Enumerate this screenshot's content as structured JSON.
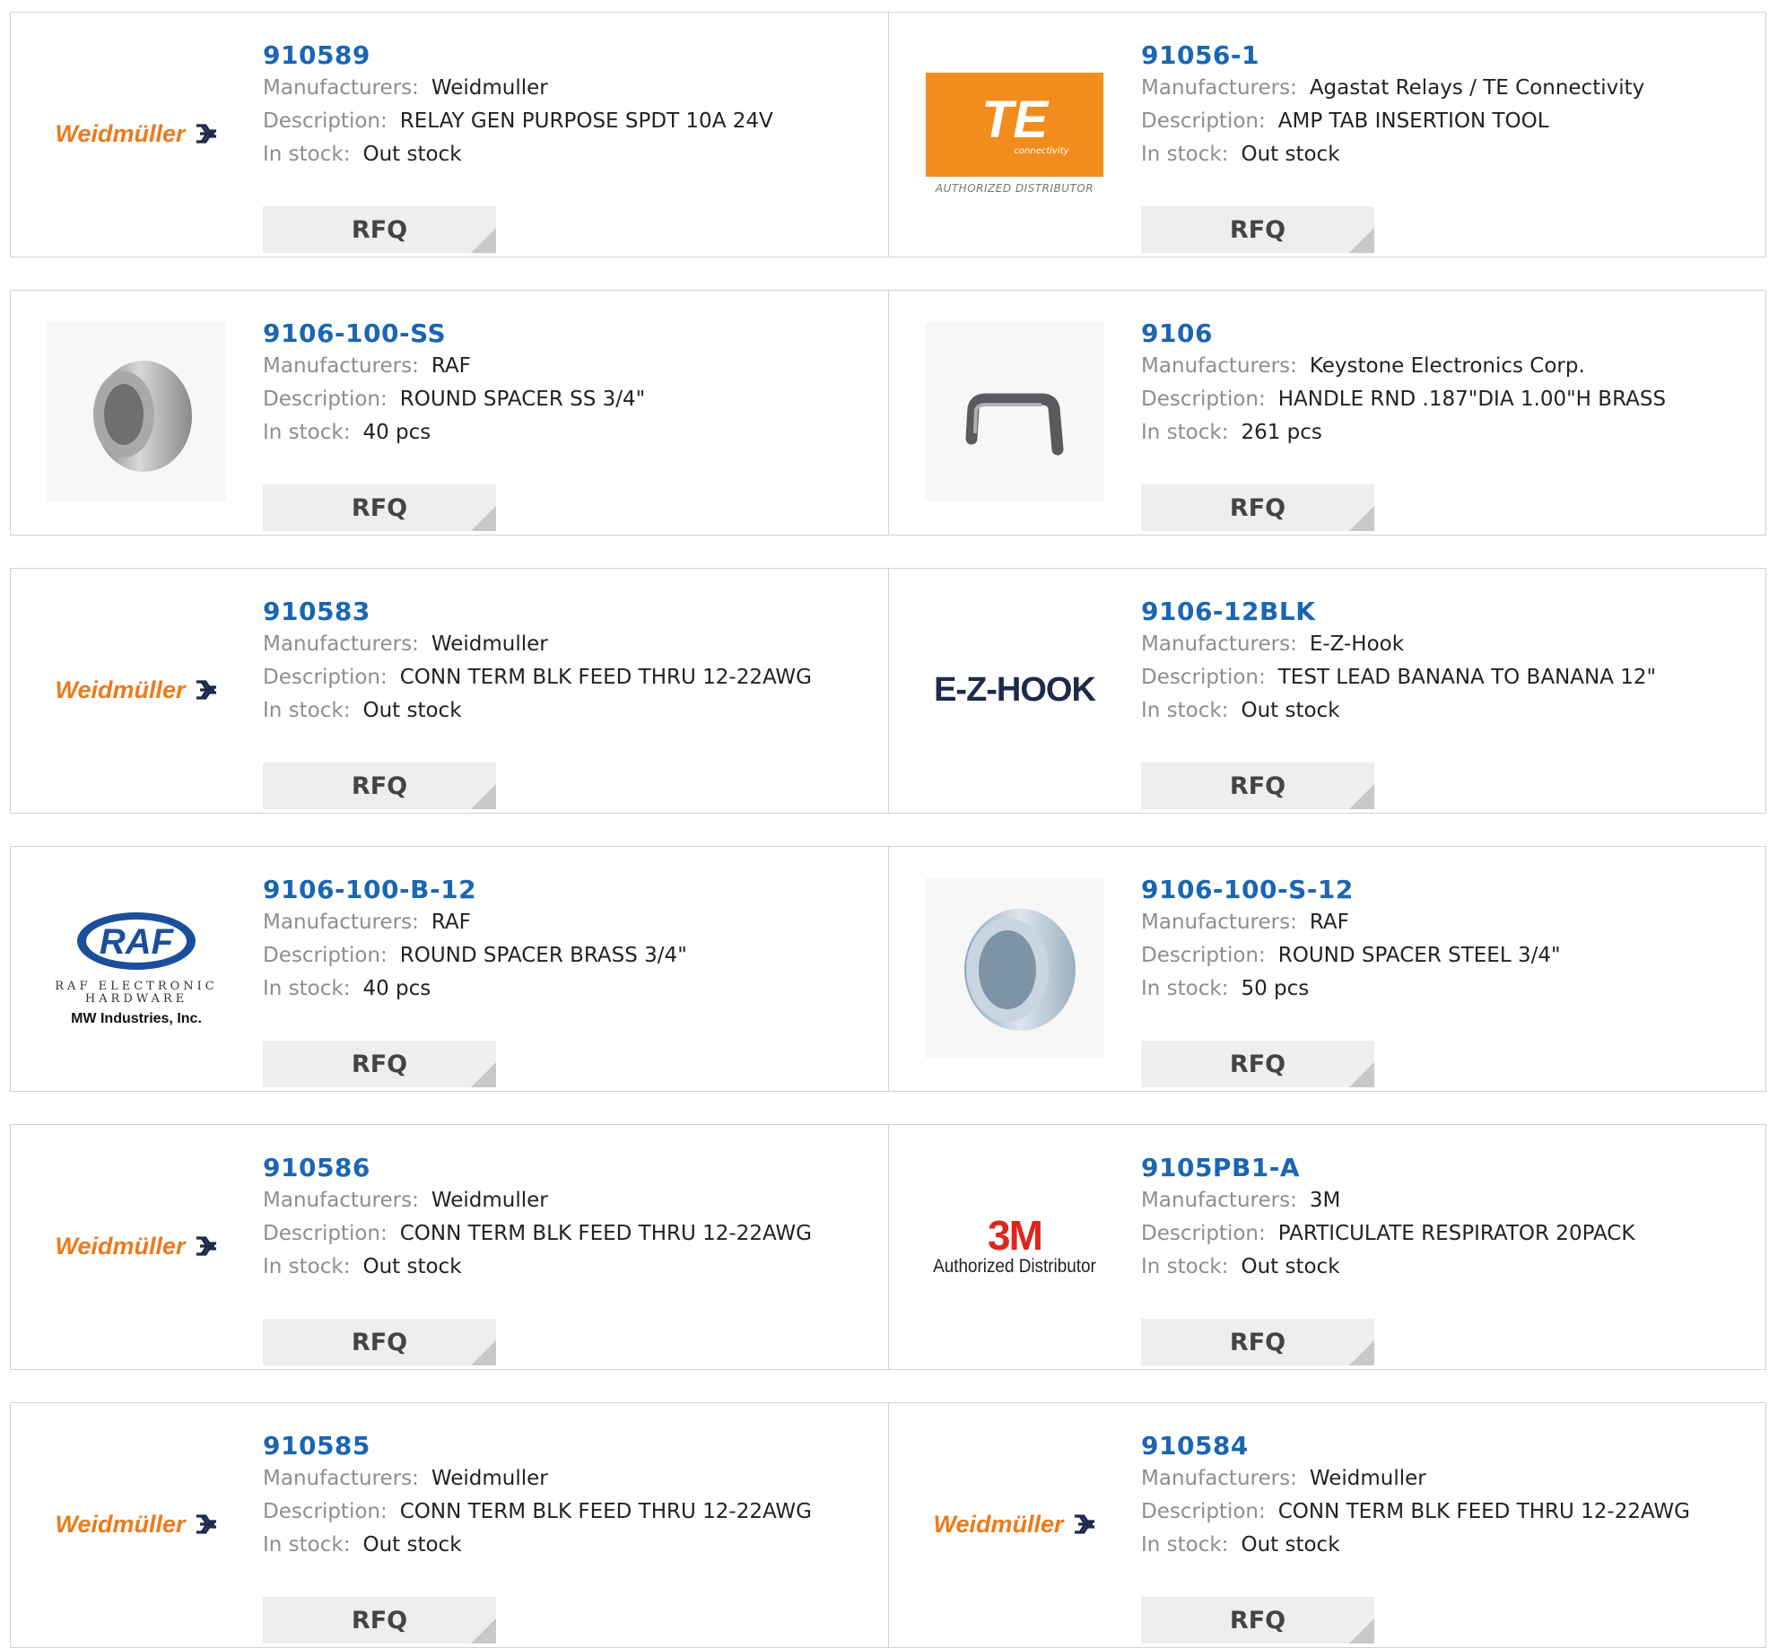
{
  "rfq_label": "RFQ",
  "labels": {
    "manufacturers": "Manufacturers:",
    "description": "Description:",
    "in_stock": "In stock:"
  },
  "logos": {
    "weidmuller": "Weidmüller",
    "te": "TE",
    "te_sub": "connectivity",
    "te_auth": "AUTHORIZED DISTRIBUTOR",
    "ezhook": "E-Z-HOOK",
    "raf": "RAF",
    "raf_sub1": "RAF ELECTRONIC",
    "raf_sub1b": "HARDWARE",
    "raf_sub2": "MW Industries, Inc.",
    "m3": "3M",
    "m3_auth": "Authorized Distributor"
  },
  "colors": {
    "part_link": "#1a66b3",
    "weidmuller_orange": "#ec7a1b",
    "te_orange": "#f28c1c",
    "m3_red": "#e1251b"
  },
  "products": [
    {
      "part": "910589",
      "manufacturer": "Weidmuller",
      "description": "RELAY GEN PURPOSE SPDT 10A 24V",
      "stock": "Out stock",
      "logo": "weidmuller"
    },
    {
      "part": "91056-1",
      "manufacturer": "Agastat Relays / TE Connectivity",
      "description": "AMP TAB INSERTION TOOL",
      "stock": "Out stock",
      "logo": "te"
    },
    {
      "part": "9106-100-SS",
      "manufacturer": "RAF",
      "description": "ROUND SPACER SS 3/4\"",
      "stock": "40 pcs",
      "logo": "photo-spacer-ss"
    },
    {
      "part": "9106",
      "manufacturer": "Keystone Electronics Corp.",
      "description": "HANDLE RND .187\"DIA 1.00\"H BRASS",
      "stock": "261 pcs",
      "logo": "photo-handle"
    },
    {
      "part": "910583",
      "manufacturer": "Weidmuller",
      "description": "CONN TERM BLK FEED THRU 12-22AWG",
      "stock": "Out stock",
      "logo": "weidmuller"
    },
    {
      "part": "9106-12BLK",
      "manufacturer": "E-Z-Hook",
      "description": "TEST LEAD BANANA TO BANANA 12\"",
      "stock": "Out stock",
      "logo": "ezhook"
    },
    {
      "part": "9106-100-B-12",
      "manufacturer": "RAF",
      "description": "ROUND SPACER BRASS 3/4\"",
      "stock": "40 pcs",
      "logo": "raf"
    },
    {
      "part": "9106-100-S-12",
      "manufacturer": "RAF",
      "description": "ROUND SPACER STEEL 3/4\"",
      "stock": "50 pcs",
      "logo": "photo-spacer-steel"
    },
    {
      "part": "910586",
      "manufacturer": "Weidmuller",
      "description": "CONN TERM BLK FEED THRU 12-22AWG",
      "stock": "Out stock",
      "logo": "weidmuller"
    },
    {
      "part": "9105PB1-A",
      "manufacturer": "3M",
      "description": "PARTICULATE RESPIRATOR 20PACK",
      "stock": "Out stock",
      "logo": "3m"
    },
    {
      "part": "910585",
      "manufacturer": "Weidmuller",
      "description": "CONN TERM BLK FEED THRU 12-22AWG",
      "stock": "Out stock",
      "logo": "weidmuller"
    },
    {
      "part": "910584",
      "manufacturer": "Weidmuller",
      "description": "CONN TERM BLK FEED THRU 12-22AWG",
      "stock": "Out stock",
      "logo": "weidmuller"
    }
  ]
}
